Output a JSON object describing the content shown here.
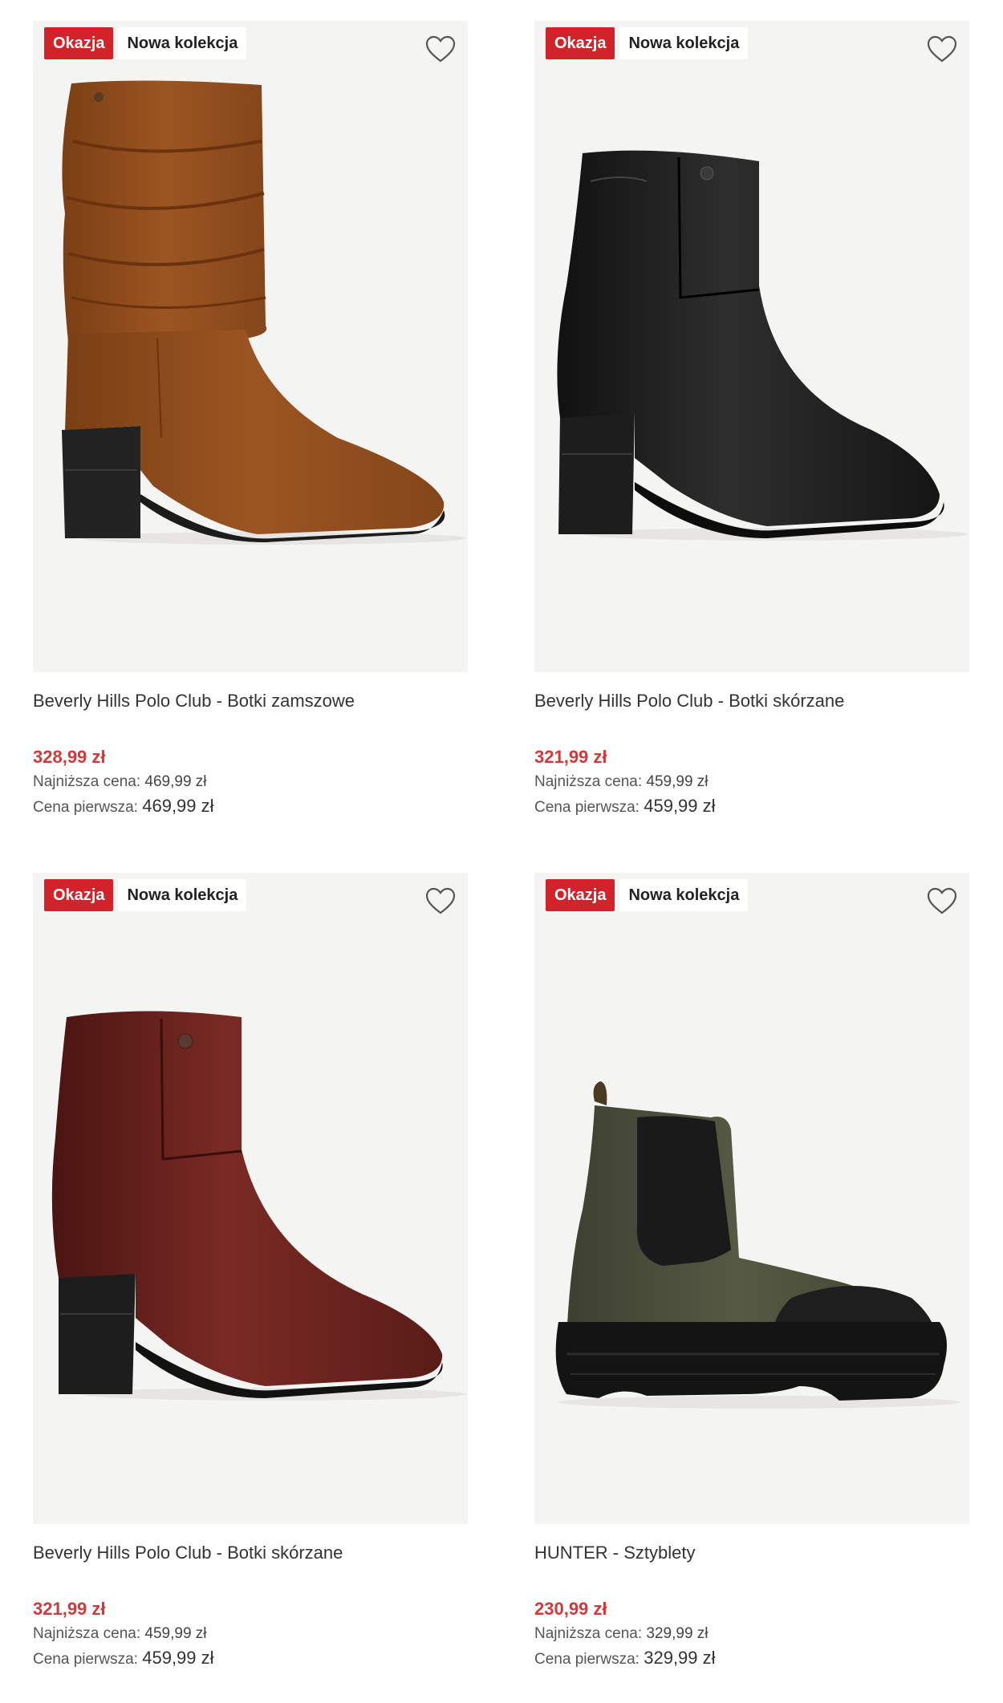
{
  "colors": {
    "accent_sale": "#d2232a",
    "price": "#cf3a3a",
    "card_bg": "#f4f4f3"
  },
  "products": [
    {
      "badge_sale": "Okazja",
      "badge_new": "Nowa kolekcja",
      "favorite_icon": "heart-outline-icon",
      "image": "brown-suede-slouch-boot",
      "name": "Beverly Hills Polo Club - Botki zamszowe",
      "price": "328,99 zł",
      "lowest_price_label": "Najniższa cena:",
      "lowest_price": "469,99 zł",
      "original_price_label": "Cena pierwsza:",
      "original_price": "469,99 zł"
    },
    {
      "badge_sale": "Okazja",
      "badge_new": "Nowa kolekcja",
      "favorite_icon": "heart-outline-icon",
      "image": "black-leather-ankle-boot",
      "name": "Beverly Hills Polo Club - Botki skórzane",
      "price": "321,99 zł",
      "lowest_price_label": "Najniższa cena:",
      "lowest_price": "459,99 zł",
      "original_price_label": "Cena pierwsza:",
      "original_price": "459,99 zł"
    },
    {
      "badge_sale": "Okazja",
      "badge_new": "Nowa kolekcja",
      "favorite_icon": "heart-outline-icon",
      "image": "burgundy-leather-ankle-boot",
      "name": "Beverly Hills Polo Club - Botki skórzane",
      "price": "321,99 zł",
      "lowest_price_label": "Najniższa cena:",
      "lowest_price": "459,99 zł",
      "original_price_label": "Cena pierwsza:",
      "original_price": "459,99 zł"
    },
    {
      "badge_sale": "Okazja",
      "badge_new": "Nowa kolekcja",
      "favorite_icon": "heart-outline-icon",
      "image": "olive-chelsea-rubber-boot",
      "name": "HUNTER - Sztyblety",
      "price": "230,99 zł",
      "lowest_price_label": "Najniższa cena:",
      "lowest_price": "329,99 zł",
      "original_price_label": "Cena pierwsza:",
      "original_price": "329,99 zł"
    }
  ]
}
